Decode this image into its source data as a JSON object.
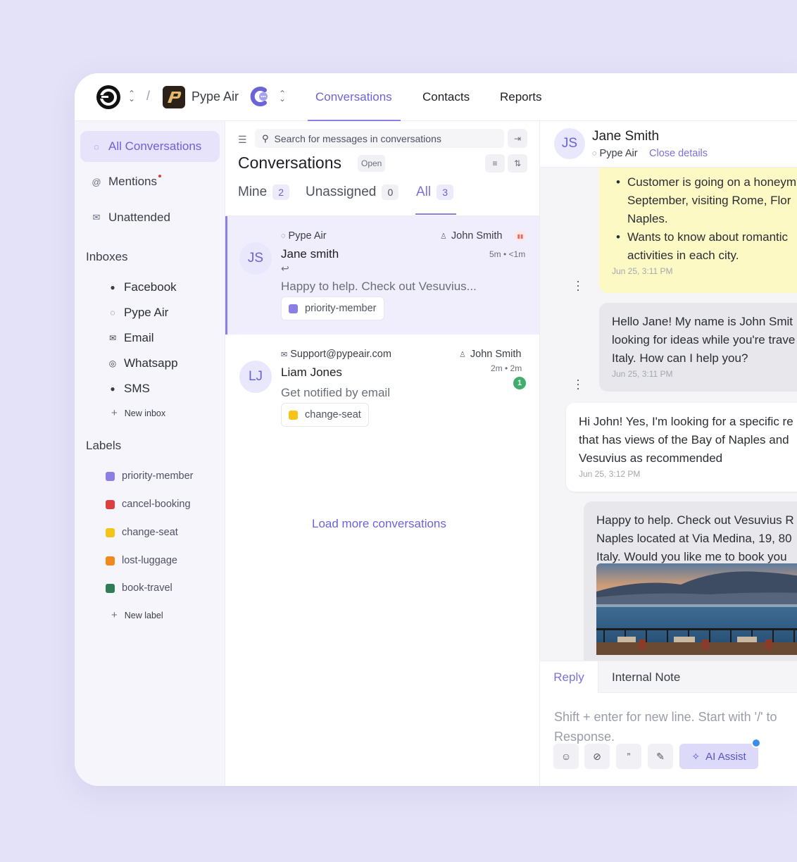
{
  "topbar": {
    "brand_name": "Pype Air",
    "nav": {
      "conversations": "Conversations",
      "contacts": "Contacts",
      "reports": "Reports"
    }
  },
  "sidebar": {
    "all_conversations": "All Conversations",
    "mentions": "Mentions",
    "unattended": "Unattended",
    "inboxes_heading": "Inboxes",
    "inboxes": [
      {
        "label": "Facebook",
        "icon": "facebook-icon"
      },
      {
        "label": "Pype Air",
        "icon": "chat-icon"
      },
      {
        "label": "Email",
        "icon": "mail-icon"
      },
      {
        "label": "Whatsapp",
        "icon": "whatsapp-icon"
      },
      {
        "label": "SMS",
        "icon": "sms-icon"
      }
    ],
    "new_inbox": "New inbox",
    "labels_heading": "Labels",
    "labels": [
      {
        "label": "priority-member",
        "color": "#8b7fe6"
      },
      {
        "label": "cancel-booking",
        "color": "#dd3f3f"
      },
      {
        "label": "change-seat",
        "color": "#f6c318"
      },
      {
        "label": "lost-luggage",
        "color": "#f08a1c"
      },
      {
        "label": "book-travel",
        "color": "#2e7d57"
      }
    ],
    "new_label": "New label"
  },
  "list": {
    "search_placeholder": "Search for messages in conversations",
    "title": "Conversations",
    "status": "Open",
    "tabs": [
      {
        "label": "Mine",
        "count": "2"
      },
      {
        "label": "Unassigned",
        "count": "0"
      },
      {
        "label": "All",
        "count": "3"
      }
    ],
    "conversations": [
      {
        "initials": "JS",
        "inbox": "Pype Air",
        "name": "Jane smith",
        "agent": "John Smith",
        "time": "5m • <1m",
        "message": "Happy to help. Check out Vesuvius...",
        "label": "priority-member",
        "label_color": "#8b7fe6"
      },
      {
        "initials": "LJ",
        "inbox": "Support@pypeair.com",
        "name": "Liam Jones",
        "agent": "John Smith",
        "time": "2m • 2m",
        "unread": "1",
        "message": "Get notified by email",
        "label": "change-seat",
        "label_color": "#f6c318"
      }
    ],
    "load_more": "Load more conversations"
  },
  "conversation": {
    "initials": "JS",
    "name": "Jane Smith",
    "inbox": "Pype Air",
    "close_details": "Close details",
    "note": {
      "bullets": [
        [
          "Customer is going on a honeym",
          "September, visiting Rome, Flor",
          "Naples."
        ],
        [
          "Wants to know about romantic",
          "activities in each city."
        ]
      ],
      "time": "Jun 25, 3:11 PM"
    },
    "messages": [
      {
        "lines": [
          "Hello Jane! My name is John Smit",
          "looking for ideas while you're trave",
          "Italy. How can I help you?"
        ],
        "time": "Jun 25, 3:11 PM"
      },
      {
        "lines": [
          "Hi John! Yes, I'm looking for a specific re",
          "that has views of the Bay of Naples and",
          "Vesuvius as recommended"
        ],
        "time": "Jun 25, 3:12 PM"
      },
      {
        "lines": [
          "Happy to help. Check out Vesuvius R",
          "Naples located at Via Medina, 19, 80",
          "Italy. Would you like me to book you"
        ]
      }
    ],
    "reply_tab": "Reply",
    "note_tab": "Internal Note",
    "composer_placeholder": [
      "Shift + enter for new line. Start with '/' to",
      "Response."
    ],
    "ai_assist": "AI Assist"
  }
}
